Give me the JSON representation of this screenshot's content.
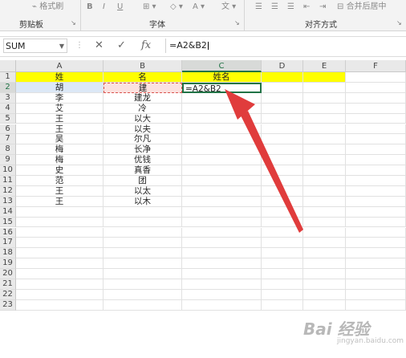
{
  "ribbon": {
    "top_items": [
      "格式刷",
      "B",
      "I",
      "U",
      "合并后居中"
    ],
    "groups": [
      {
        "label": "剪贴板"
      },
      {
        "label": "字体"
      },
      {
        "label": "对齐方式"
      }
    ]
  },
  "formula_bar": {
    "name_box": "SUM",
    "cancel_icon": "✕",
    "enter_icon": "✓",
    "fx": "fx",
    "formula": "=A2&B2"
  },
  "columns": [
    "A",
    "B",
    "C",
    "D",
    "E",
    "F"
  ],
  "rows": [
    {
      "num": "1",
      "A": "姓",
      "B": "名",
      "C": "姓名"
    },
    {
      "num": "2",
      "A": "胡",
      "B": "建",
      "C": "=A2&B2"
    },
    {
      "num": "3",
      "A": "李",
      "B": "建龙",
      "C": ""
    },
    {
      "num": "4",
      "A": "艾",
      "B": "冷",
      "C": ""
    },
    {
      "num": "5",
      "A": "王",
      "B": "以大",
      "C": ""
    },
    {
      "num": "6",
      "A": "王",
      "B": "以夫",
      "C": ""
    },
    {
      "num": "7",
      "A": "吴",
      "B": "尔凡",
      "C": ""
    },
    {
      "num": "8",
      "A": "梅",
      "B": "长净",
      "C": ""
    },
    {
      "num": "9",
      "A": "梅",
      "B": "优钱",
      "C": ""
    },
    {
      "num": "10",
      "A": "史",
      "B": "真香",
      "C": ""
    },
    {
      "num": "11",
      "A": "范",
      "B": "团",
      "C": ""
    },
    {
      "num": "12",
      "A": "王",
      "B": "以太",
      "C": ""
    },
    {
      "num": "13",
      "A": "王",
      "B": "以木",
      "C": ""
    },
    {
      "num": "14",
      "A": "",
      "B": "",
      "C": ""
    },
    {
      "num": "15",
      "A": "",
      "B": "",
      "C": ""
    },
    {
      "num": "16",
      "A": "",
      "B": "",
      "C": ""
    },
    {
      "num": "17",
      "A": "",
      "B": "",
      "C": ""
    },
    {
      "num": "18",
      "A": "",
      "B": "",
      "C": ""
    },
    {
      "num": "19",
      "A": "",
      "B": "",
      "C": ""
    },
    {
      "num": "20",
      "A": "",
      "B": "",
      "C": ""
    },
    {
      "num": "21",
      "A": "",
      "B": "",
      "C": ""
    },
    {
      "num": "22",
      "A": "",
      "B": "",
      "C": ""
    },
    {
      "num": "23",
      "A": "",
      "B": "",
      "C": ""
    }
  ],
  "colors": {
    "header_fill": "#ffff00",
    "accent": "#217346",
    "arrow": "#e03c3c"
  },
  "watermark": {
    "text": "Bai 经验",
    "sub": "jingyan.baidu.com"
  }
}
